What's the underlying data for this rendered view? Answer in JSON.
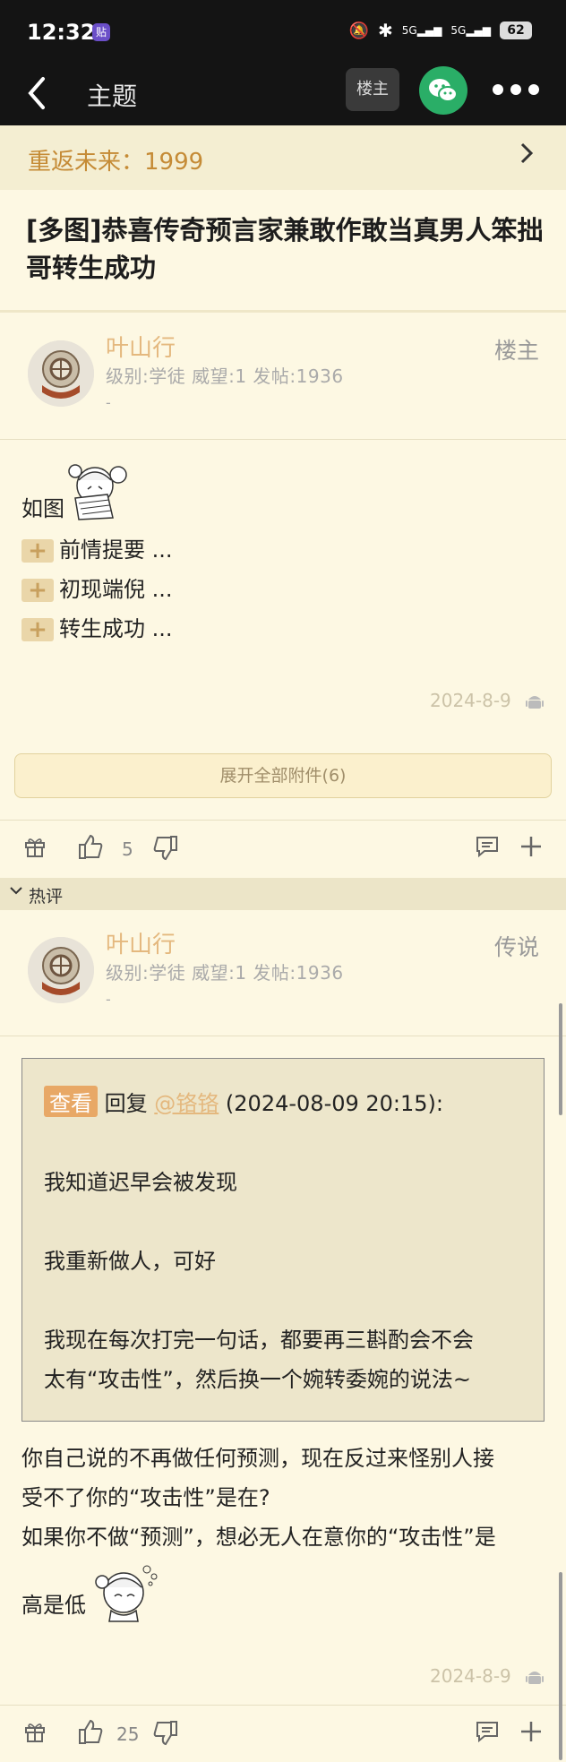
{
  "status_bar": {
    "time": "12:32",
    "app_badge": "贴",
    "network1": "5G",
    "network2": "5G",
    "battery": "62"
  },
  "nav": {
    "title": "主题",
    "louzhu_label": "楼主"
  },
  "forum": {
    "name": "重返未来：1999"
  },
  "thread": {
    "title": "[多图]恭喜传奇预言家兼敢作敢当真男人笨拙哥转生成功"
  },
  "post1": {
    "author": "叶山行",
    "meta": "级别:学徒 威望:1 发帖:1936",
    "dash": "-",
    "role": "楼主",
    "text": "如图",
    "spoilers": [
      "前情提要 ...",
      "初现端倪 ...",
      "转生成功 ..."
    ],
    "date": "2024-8-9",
    "attach_label": "展开全部附件(6)",
    "likes": "5"
  },
  "hot_label": "热评",
  "post2": {
    "author": "叶山行",
    "meta": "级别:学徒 威望:1 发帖:1936",
    "dash": "-",
    "role": "传说",
    "quote": {
      "view_label": "查看",
      "reply_word": "回复",
      "mention": "@铬铬",
      "time": "(2024-08-09 20:15):",
      "lines": [
        "我知道迟早会被发现",
        "我重新做人，可好",
        "我现在每次打完一句话，都要再三斟酌会不会",
        "太有“攻击性”，然后换一个婉转委婉的说法~"
      ]
    },
    "body": [
      "你自己说的不再做任何预测，现在反过来怪别人接",
      "受不了你的“攻击性”是在?",
      "如果你不做“预测”，想必无人在意你的“攻击性”是",
      "高是低"
    ],
    "date": "2024-8-9",
    "likes": "25"
  }
}
